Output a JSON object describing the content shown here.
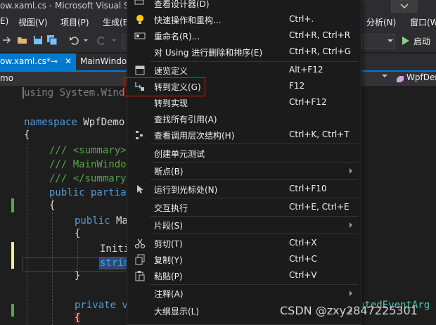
{
  "window": {
    "title": "ow.xaml.cs - Microsoft Visual Studio"
  },
  "menubar": {
    "items_left": [
      "E)",
      "视图(V)",
      "项目(P)",
      "生成(B"
    ],
    "items_right": [
      "分析(N)",
      "窗口(W"
    ]
  },
  "toolbar": {
    "run_label": "启动"
  },
  "tabs": [
    {
      "label": "ow.xaml.cs*",
      "active": true,
      "pin": "⊸",
      "close": "✕"
    },
    {
      "label": "MainWindow"
    }
  ],
  "navbar": {
    "left": "mo",
    "right": "WpfDem"
  },
  "code": {
    "line1": "using System.Wind",
    "line2_kw": "namespace",
    "line2_tx": " WpfDemo",
    "line3": "{",
    "line4": "/// <summary>",
    "line5": "/// MainWindo",
    "line6": "/// </summary>",
    "line7_kw": "public partia",
    "line8": "{",
    "line9_kw": "public",
    "line9_tx": " Ma",
    "line10": "{",
    "line11": "Initi",
    "line12": "strin",
    "line13": "}",
    "line14_kw": "private v",
    "line15": "{",
    "right_frag": "utedEventArg"
  },
  "context_menu": {
    "items": [
      {
        "label": "查看设计器(D)",
        "shortcut": "",
        "icon": "designer-icon"
      },
      {
        "label": "快速操作和重构...",
        "shortcut": "Ctrl+.",
        "icon": "lightbulb-icon"
      },
      {
        "label": "重命名(R)...",
        "shortcut": "Ctrl+R, Ctrl+R",
        "icon": "rename-icon"
      },
      {
        "label": "对 Using 进行删除和排序(E)",
        "shortcut": "Ctrl+R, Ctrl+G",
        "icon": ""
      },
      {
        "label": "速览定义",
        "shortcut": "Alt+F12",
        "icon": "peek-icon"
      },
      {
        "label": "转到定义(G)",
        "shortcut": "F12",
        "icon": "goto-definition-icon"
      },
      {
        "label": "转到实现",
        "shortcut": "Ctrl+F12",
        "icon": ""
      },
      {
        "label": "查找所有引用(A)",
        "shortcut": "",
        "icon": ""
      },
      {
        "label": "查看调用层次结构(H)",
        "shortcut": "Ctrl+K, Ctrl+T",
        "icon": "call-hierarchy-icon"
      },
      {
        "label": "创建单元测试",
        "shortcut": "",
        "icon": ""
      },
      {
        "label": "断点(B)",
        "shortcut": "",
        "icon": "",
        "submenu": true
      },
      {
        "label": "运行到光标处(N)",
        "shortcut": "Ctrl+F10",
        "icon": "run-to-cursor-icon"
      },
      {
        "label": "交互执行",
        "shortcut": "Ctrl+E, Ctrl+E",
        "icon": ""
      },
      {
        "label": "片段(S)",
        "shortcut": "",
        "icon": "",
        "submenu": true
      },
      {
        "label": "剪切(T)",
        "shortcut": "Ctrl+X",
        "icon": "cut-icon"
      },
      {
        "label": "复制(Y)",
        "shortcut": "Ctrl+C",
        "icon": "copy-icon"
      },
      {
        "label": "粘贴(P)",
        "shortcut": "Ctrl+V",
        "icon": "paste-icon"
      },
      {
        "label": "注释(A)",
        "shortcut": "",
        "icon": "",
        "submenu": true
      },
      {
        "label": "大纲显示(L)",
        "shortcut": "",
        "icon": "",
        "submenu": true
      }
    ]
  },
  "watermark": "CSDN @zxy2847225301",
  "colors": {
    "accent": "#007acc",
    "highlight_box": "#e51400",
    "background": "#1e1e1e"
  }
}
